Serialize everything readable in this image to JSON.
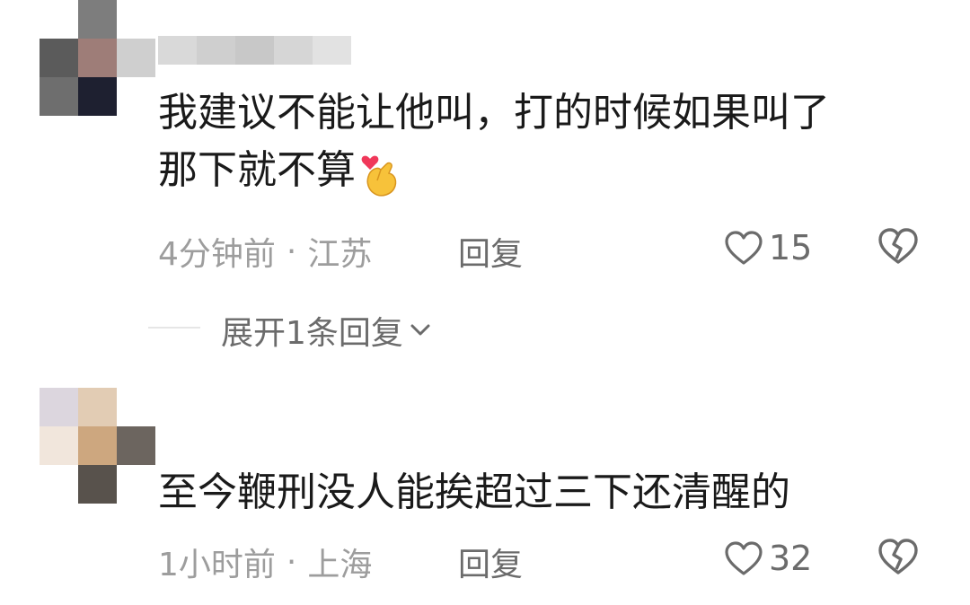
{
  "comments": [
    {
      "text_line1": "我建议不能让他叫，打的时候如果叫了",
      "text_line2": "那下就不算",
      "emoji": "finger-heart-emoji",
      "time": "4分钟前",
      "dot": "·",
      "location": "江苏",
      "reply_label": "回复",
      "likes": "15",
      "avatar_colors": [
        "#7d7d7d",
        "#5b5b5b",
        "#9e7d78",
        "#cfcfcf",
        "#6e6e6e",
        "#1e2030",
        "#ffffff"
      ],
      "username_colors": [
        "#d9d9d9",
        "#cfcfcf",
        "#c8c8c8",
        "#d6d6d6",
        "#e2e2e2"
      ]
    },
    {
      "text_line1": "至今鞭刑没人能挨超过三下还清醒的",
      "time": "1小时前",
      "dot": "·",
      "location": "上海",
      "reply_label": "回复",
      "likes": "32",
      "avatar_colors": [
        "#dcd6de",
        "#e2ccb4",
        "#f1e6dc",
        "#cda77f",
        "#6c655f",
        "#ffffff",
        "#58524c"
      ]
    }
  ],
  "expand_replies": {
    "label": "展开1条回复"
  },
  "icons": {
    "like": "heart-outline-icon",
    "dislike": "broken-heart-icon",
    "chevron": "chevron-down-icon"
  },
  "colors": {
    "text": "#1a1a1a",
    "meta": "#9d9d9d",
    "action": "#6b6b6b"
  }
}
